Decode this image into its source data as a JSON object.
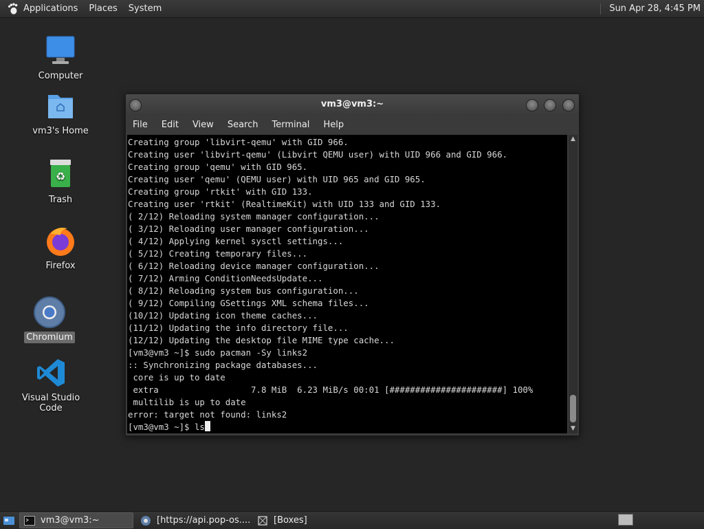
{
  "top_panel": {
    "menus": [
      "Applications",
      "Places",
      "System"
    ],
    "clock": "Sun Apr 28,  4:45 PM"
  },
  "desktop": {
    "icons": [
      {
        "label": "Computer",
        "icon": "computer-icon"
      },
      {
        "label": "vm3's Home",
        "icon": "home-folder-icon"
      },
      {
        "label": "Trash",
        "icon": "trash-icon"
      },
      {
        "label": "Firefox",
        "icon": "firefox-icon"
      },
      {
        "label": "Chromium",
        "icon": "chromium-icon"
      },
      {
        "label": "Visual Studio Code",
        "icon": "vscode-icon"
      }
    ]
  },
  "terminal": {
    "title": "vm3@vm3:~",
    "menu": [
      "File",
      "Edit",
      "View",
      "Search",
      "Terminal",
      "Help"
    ],
    "lines": [
      "Creating group 'libvirt-qemu' with GID 966.",
      "Creating user 'libvirt-qemu' (Libvirt QEMU user) with UID 966 and GID 966.",
      "Creating group 'qemu' with GID 965.",
      "Creating user 'qemu' (QEMU user) with UID 965 and GID 965.",
      "Creating group 'rtkit' with GID 133.",
      "Creating user 'rtkit' (RealtimeKit) with UID 133 and GID 133.",
      "( 2/12) Reloading system manager configuration...",
      "( 3/12) Reloading user manager configuration...",
      "( 4/12) Applying kernel sysctl settings...",
      "( 5/12) Creating temporary files...",
      "( 6/12) Reloading device manager configuration...",
      "( 7/12) Arming ConditionNeedsUpdate...",
      "( 8/12) Reloading system bus configuration...",
      "( 9/12) Compiling GSettings XML schema files...",
      "(10/12) Updating icon theme caches...",
      "(11/12) Updating the info directory file...",
      "(12/12) Updating the desktop file MIME type cache...",
      "[vm3@vm3 ~]$ sudo pacman -Sy links2",
      ":: Synchronizing package databases...",
      " core is up to date",
      " extra                  7.8 MiB  6.23 MiB/s 00:01 [######################] 100%",
      " multilib is up to date",
      "error: target not found: links2"
    ],
    "prompt": "[vm3@vm3 ~]$ ls"
  },
  "taskbar": {
    "tasks": [
      {
        "label": "vm3@vm3:~",
        "icon": "terminal-icon",
        "active": true
      },
      {
        "label": "[https://api.pop-os....",
        "icon": "chromium-icon",
        "active": false
      },
      {
        "label": "[Boxes]",
        "icon": "boxes-icon",
        "active": false
      }
    ]
  }
}
